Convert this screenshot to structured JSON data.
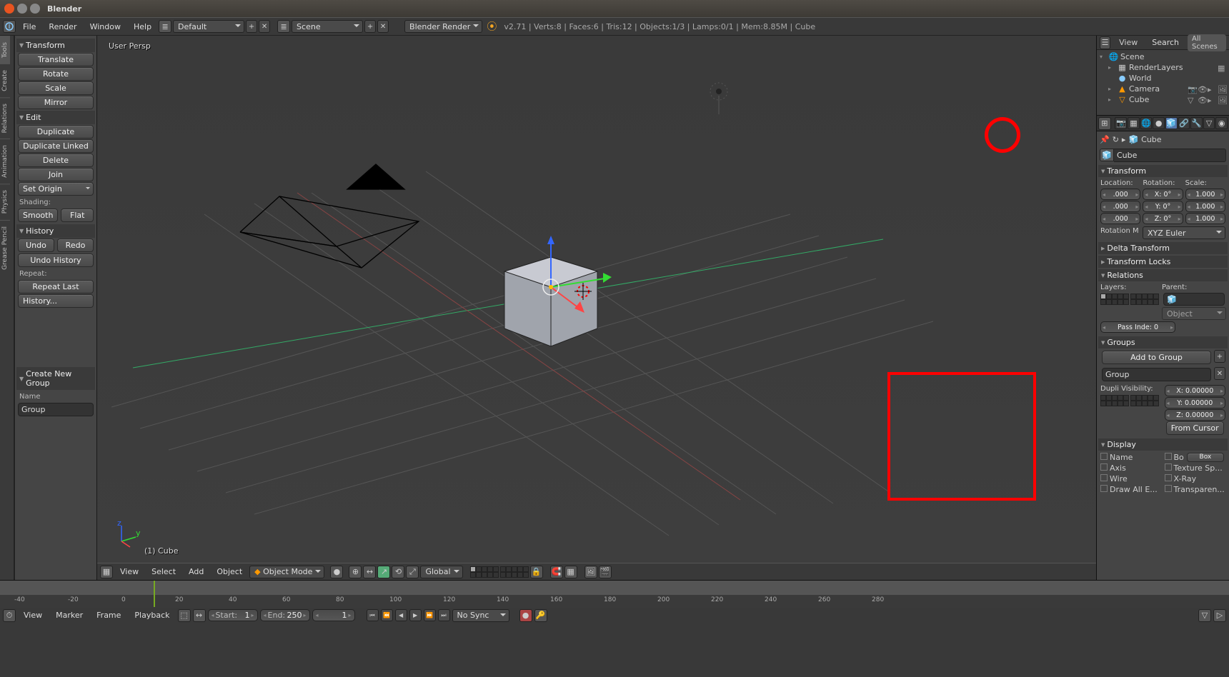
{
  "os": {
    "title": "Blender"
  },
  "menu": {
    "file": "File",
    "render": "Render",
    "window": "Window",
    "help": "Help"
  },
  "layout_selected": "Default",
  "scene_selected": "Scene",
  "engine_selected": "Blender Render",
  "stats": "v2.71 | Verts:8 | Faces:6 | Tris:12 | Objects:1/3 | Lamps:0/1 | Mem:8.85M | Cube",
  "sidebar_tabs": [
    "Tools",
    "Create",
    "Relations",
    "Animation",
    "Physics",
    "Grease Pencil"
  ],
  "toolpanel": {
    "transform_hdr": "Transform",
    "translate": "Translate",
    "rotate": "Rotate",
    "scale": "Scale",
    "mirror": "Mirror",
    "edit_hdr": "Edit",
    "duplicate": "Duplicate",
    "duplicate_linked": "Duplicate Linked",
    "delete": "Delete",
    "join": "Join",
    "set_origin": "Set Origin",
    "shading_lbl": "Shading:",
    "smooth": "Smooth",
    "flat": "Flat",
    "history_hdr": "History",
    "undo": "Undo",
    "redo": "Redo",
    "undo_history": "Undo History",
    "repeat_lbl": "Repeat:",
    "repeat_last": "Repeat Last",
    "history_btn": "History..."
  },
  "op_panel": {
    "hdr": "Create New Group",
    "name_lbl": "Name",
    "name_val": "Group"
  },
  "viewport": {
    "persp": "User Persp",
    "objlabel": "(1) Cube",
    "menu_view": "View",
    "menu_select": "Select",
    "menu_add": "Add",
    "menu_object": "Object",
    "mode": "Object Mode",
    "orient": "Global"
  },
  "outliner": {
    "view": "View",
    "search": "Search",
    "all_scenes": "All Scenes",
    "scene": "Scene",
    "renderlayers": "RenderLayers",
    "world": "World",
    "camera": "Camera",
    "cube": "Cube"
  },
  "props": {
    "crumb": "Cube",
    "name": "Cube",
    "transform_hdr": "Transform",
    "loc_lbl": "Location:",
    "rot_lbl": "Rotation:",
    "scale_lbl": "Scale:",
    "loc": [
      ".000",
      ".000",
      ".000"
    ],
    "rot": [
      "X: 0°",
      "Y: 0°",
      "Z: 0°"
    ],
    "scale": [
      "1.000",
      "1.000",
      "1.000"
    ],
    "rotmode_lbl": "Rotation M",
    "rotmode": "XYZ Euler",
    "delta_hdr": "Delta Transform",
    "locks_hdr": "Transform Locks",
    "relations_hdr": "Relations",
    "layers_lbl": "Layers:",
    "parent_lbl": "Parent:",
    "parent_type": "Object",
    "pass_index": "Pass Inde: 0",
    "groups_hdr": "Groups",
    "add_to_group": "Add to Group",
    "group_name": "Group",
    "dupli_lbl": "Dupli Visibility:",
    "dupli": [
      "X: 0.00000",
      "Y: 0.00000",
      "Z: 0.00000"
    ],
    "from_cursor": "From Cursor",
    "display_hdr": "Display",
    "disp_name": "Name",
    "disp_axis": "Axis",
    "disp_wire": "Wire",
    "disp_drawall": "Draw All E...",
    "disp_bo": "Bo",
    "disp_box": "Box",
    "disp_tex": "Texture Sp...",
    "disp_xray": "X-Ray",
    "disp_transp": "Transparen..."
  },
  "timeline": {
    "marks": [
      "-40",
      "-20",
      "0",
      "20",
      "40",
      "60",
      "80",
      "100",
      "120",
      "140",
      "160",
      "180",
      "200",
      "220",
      "240",
      "260",
      "280"
    ],
    "menu_view": "View",
    "menu_marker": "Marker",
    "menu_frame": "Frame",
    "menu_playback": "Playback",
    "start_lbl": "Start:",
    "start": "1",
    "end_lbl": "End:",
    "end": "250",
    "cur": "1",
    "sync": "No Sync"
  }
}
